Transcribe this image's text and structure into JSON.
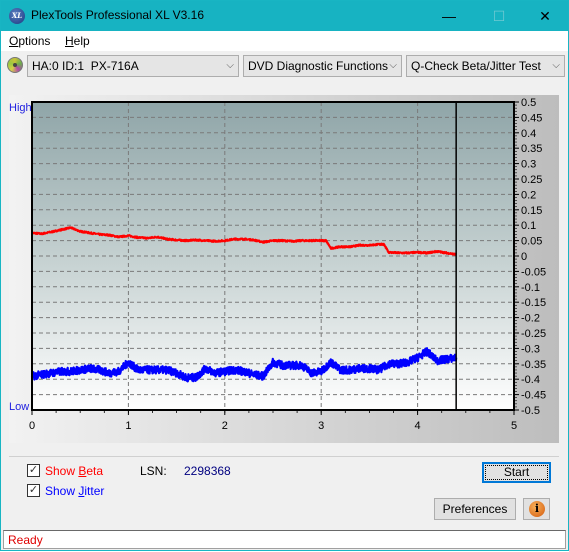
{
  "window": {
    "title": "PlexTools Professional XL V3.16",
    "app_icon": "plextools-xl-logo-icon",
    "controls": {
      "minimize": "—",
      "maximize": "☐",
      "close": "✕"
    }
  },
  "menu": {
    "items": [
      {
        "label": "Options",
        "mnemonic": "O"
      },
      {
        "label": "Help",
        "mnemonic": "H"
      }
    ]
  },
  "toolbar": {
    "drive_icon": "optical-disc-icon",
    "drive_select": "HA:0 ID:1  PX-716A",
    "function_select": "DVD Diagnostic Functions",
    "test_select": "Q-Check Beta/Jitter Test",
    "chevron": "⌵"
  },
  "chart": {
    "left_label_high": "High",
    "left_label_low": "Low"
  },
  "chart_data": {
    "type": "line",
    "title": "",
    "xlabel": "",
    "ylabel": "",
    "xlim": [
      0,
      5
    ],
    "ylim": [
      -0.5,
      0.5
    ],
    "x_ticks": [
      "0",
      "1",
      "2",
      "3",
      "4",
      "5"
    ],
    "y_ticks": [
      "0.5",
      "0.45",
      "0.4",
      "0.35",
      "0.3",
      "0.25",
      "0.2",
      "0.15",
      "0.1",
      "0.05",
      "0",
      "-0.05",
      "-0.1",
      "-0.15",
      "-0.2",
      "-0.25",
      "-0.3",
      "-0.35",
      "-0.4",
      "-0.45",
      "-0.5"
    ],
    "grid": true,
    "end_marker_x": 4.4,
    "series": [
      {
        "name": "Beta",
        "color": "#ff0000",
        "x": [
          0,
          0.1,
          0.2,
          0.3,
          0.4,
          0.5,
          0.6,
          0.7,
          0.8,
          0.9,
          1.0,
          1.1,
          1.2,
          1.3,
          1.4,
          1.5,
          1.6,
          1.7,
          1.8,
          1.9,
          2.0,
          2.1,
          2.2,
          2.3,
          2.4,
          2.5,
          2.6,
          2.7,
          2.8,
          2.9,
          3.0,
          3.05,
          3.1,
          3.2,
          3.3,
          3.4,
          3.5,
          3.6,
          3.65,
          3.7,
          3.8,
          3.9,
          4.0,
          4.1,
          4.2,
          4.3,
          4.4
        ],
        "values": [
          0.075,
          0.072,
          0.078,
          0.085,
          0.092,
          0.08,
          0.075,
          0.07,
          0.068,
          0.062,
          0.066,
          0.06,
          0.058,
          0.062,
          0.055,
          0.052,
          0.05,
          0.052,
          0.05,
          0.048,
          0.05,
          0.055,
          0.055,
          0.052,
          0.045,
          0.05,
          0.05,
          0.048,
          0.05,
          0.05,
          0.05,
          0.05,
          0.025,
          0.03,
          0.03,
          0.035,
          0.035,
          0.038,
          0.038,
          0.012,
          0.01,
          0.01,
          0.012,
          0.01,
          0.015,
          0.01,
          0.005
        ]
      },
      {
        "name": "Jitter",
        "color": "#0000ff",
        "x": [
          0,
          0.1,
          0.2,
          0.3,
          0.4,
          0.5,
          0.6,
          0.7,
          0.8,
          0.9,
          1.0,
          1.1,
          1.2,
          1.3,
          1.4,
          1.5,
          1.6,
          1.7,
          1.8,
          1.9,
          2.0,
          2.1,
          2.2,
          2.3,
          2.4,
          2.5,
          2.6,
          2.7,
          2.8,
          2.9,
          3.0,
          3.1,
          3.2,
          3.3,
          3.4,
          3.5,
          3.6,
          3.7,
          3.8,
          3.9,
          4.0,
          4.1,
          4.2,
          4.3,
          4.4
        ],
        "values": [
          -0.39,
          -0.385,
          -0.38,
          -0.375,
          -0.375,
          -0.37,
          -0.365,
          -0.37,
          -0.38,
          -0.375,
          -0.345,
          -0.37,
          -0.37,
          -0.37,
          -0.37,
          -0.38,
          -0.395,
          -0.395,
          -0.365,
          -0.38,
          -0.375,
          -0.37,
          -0.375,
          -0.385,
          -0.39,
          -0.345,
          -0.355,
          -0.355,
          -0.355,
          -0.38,
          -0.375,
          -0.345,
          -0.37,
          -0.37,
          -0.365,
          -0.365,
          -0.37,
          -0.35,
          -0.35,
          -0.345,
          -0.33,
          -0.31,
          -0.34,
          -0.335,
          -0.33
        ],
        "spread": 0.025
      }
    ]
  },
  "controls": {
    "show_beta": {
      "label": "Show Beta",
      "mnemonic": "B",
      "checked": true,
      "color": "#ff0000"
    },
    "show_jitter": {
      "label": "Show Jitter",
      "mnemonic": "J",
      "checked": true,
      "color": "#0000ff"
    },
    "lsn_label": "LSN:",
    "lsn_value": "2298368",
    "start_button": "Start",
    "preferences_button": "Preferences",
    "info_button_icon": "info-icon"
  },
  "status": {
    "text": "Ready"
  }
}
